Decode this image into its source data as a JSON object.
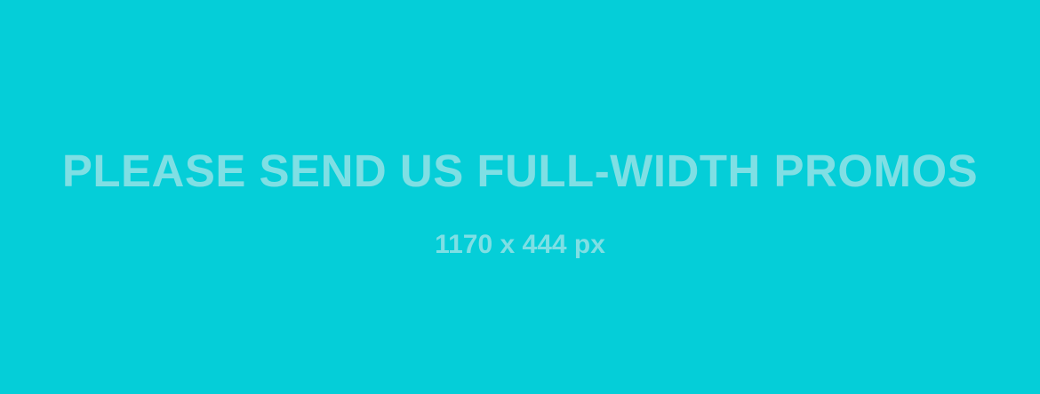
{
  "banner": {
    "headline": "PLEASE SEND US FULL-WIDTH PROMOS",
    "dimensions": "1170 x 444 px",
    "background_color": "#05ced8",
    "text_color": "#7fdfe4"
  }
}
